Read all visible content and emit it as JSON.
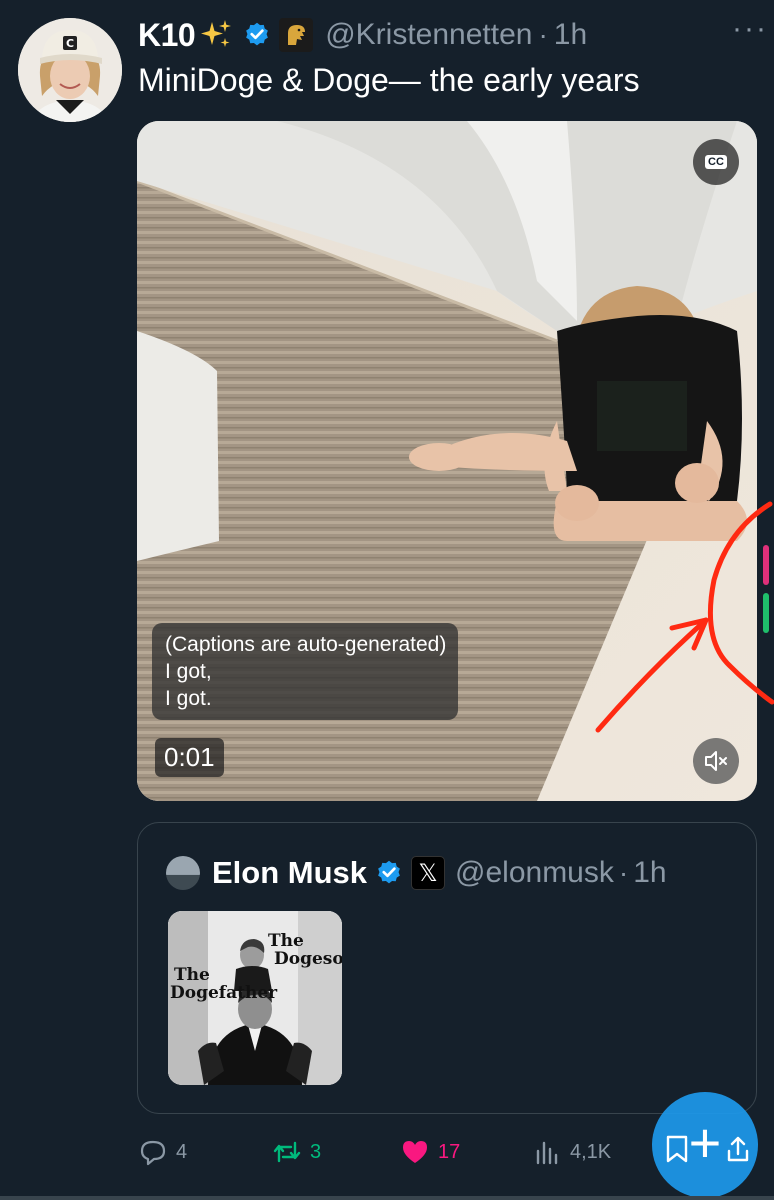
{
  "tweet": {
    "author": {
      "display_name": "K10",
      "handle": "@Kristennetten",
      "time": "1h"
    },
    "text": "MiniDoge & Doge— the early years",
    "media": {
      "captions": [
        "(Captions are auto-generated)",
        "I got,",
        "I got."
      ],
      "timecode": "0:01",
      "cc_label": "CC"
    },
    "quote": {
      "display_name": "Elon Musk",
      "handle": "@elonmusk",
      "time": "1h",
      "x_badge": "𝕏",
      "poster_text": {
        "line1": "The",
        "line2": "Dogeson",
        "line3": "The",
        "line4": "Dogefather"
      }
    },
    "stats": {
      "replies": "4",
      "retweets": "3",
      "likes": "17",
      "views": "4,1K"
    }
  },
  "colors": {
    "background": "#15202b",
    "accent_blue": "#1d9bf0",
    "muted_text": "#8b98a5",
    "retweet_green": "#00ba7c",
    "like_pink": "#f91880",
    "annotation_red": "#ff2a12"
  },
  "icons": {
    "more": "more-horizontal-icon",
    "reply": "reply-icon",
    "retweet": "retweet-icon",
    "like": "heart-icon",
    "views": "views-icon",
    "bookmark": "bookmark-icon",
    "share": "share-icon",
    "mute": "speaker-muted-icon",
    "cc": "closed-captions-icon"
  },
  "fab": {
    "plus_label": "+"
  }
}
